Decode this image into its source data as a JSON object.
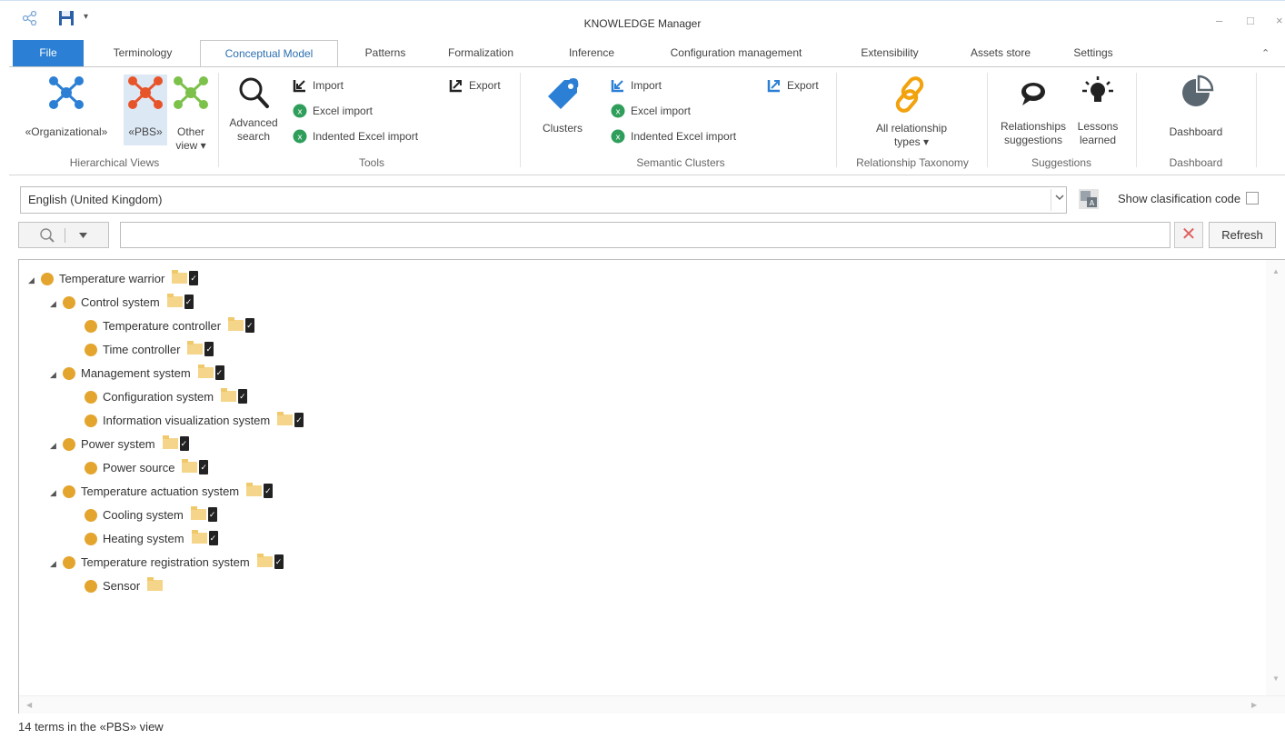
{
  "window": {
    "title": "KNOWLEDGE Manager",
    "quick_access": [
      "share-icon",
      "save-icon",
      "customize-quick-access-icon"
    ],
    "controls": [
      "–",
      "□",
      "×"
    ]
  },
  "tabs": [
    {
      "label": "File"
    },
    {
      "label": "Terminology"
    },
    {
      "label": "Conceptual Model",
      "active": true
    },
    {
      "label": "Patterns"
    },
    {
      "label": "Formalization"
    },
    {
      "label": "Inference"
    },
    {
      "label": "Configuration management"
    },
    {
      "label": "Extensibility"
    },
    {
      "label": "Assets store"
    },
    {
      "label": "Settings"
    }
  ],
  "ribbon": {
    "hierarchical_views": {
      "label": "Hierarchical Views",
      "organizational": "«Organizational»",
      "pbs": "«PBS»",
      "other_view_1": "Other",
      "other_view_2": "view ▾"
    },
    "tools": {
      "label": "Tools",
      "advanced_search_1": "Advanced",
      "advanced_search_2": "search",
      "import": "Import",
      "excel_import": "Excel import",
      "indented_excel_import": "Indented Excel import",
      "export": "Export"
    },
    "semantic_clusters": {
      "label": "Semantic Clusters",
      "clusters": "Clusters",
      "import": "Import",
      "excel_import": "Excel import",
      "indented_excel_import": "Indented Excel import",
      "export": "Export"
    },
    "relationship_taxonomy": {
      "label": "Relationship Taxonomy",
      "all_types_1": "All relationship",
      "all_types_2": "types ▾"
    },
    "suggestions": {
      "label": "Suggestions",
      "relationships_1": "Relationships",
      "relationships_2": "suggestions",
      "lessons_1": "Lessons",
      "lessons_2": "learned"
    },
    "dashboard": {
      "label": "Dashboard",
      "button": "Dashboard"
    },
    "colors": {
      "accent_blue": "#2b7fd4",
      "pbs_red": "#e8542a",
      "node_green": "#7cc14a",
      "link_orange": "#f2a20d",
      "excel_green": "#2f9e5b"
    }
  },
  "language": {
    "selected": "English (United Kingdom)",
    "show_code_label": "Show clasification code"
  },
  "search": {
    "value": "",
    "refresh_label": "Refresh"
  },
  "tree": [
    {
      "label": "Temperature warrior",
      "level": 0,
      "expanded": true
    },
    {
      "label": "Control system",
      "level": 1,
      "expanded": true
    },
    {
      "label": "Temperature controller",
      "level": 2
    },
    {
      "label": "Time controller",
      "level": 2
    },
    {
      "label": "Management system",
      "level": 1,
      "expanded": true
    },
    {
      "label": "Configuration system",
      "level": 2
    },
    {
      "label": "Information visualization system",
      "level": 2
    },
    {
      "label": "Power system",
      "level": 1,
      "expanded": true
    },
    {
      "label": "Power source",
      "level": 2
    },
    {
      "label": "Temperature actuation system",
      "level": 1,
      "expanded": true
    },
    {
      "label": "Cooling system",
      "level": 2
    },
    {
      "label": "Heating system",
      "level": 2
    },
    {
      "label": "Temperature registration system",
      "level": 1,
      "expanded": true
    },
    {
      "label": "Sensor",
      "level": 2,
      "no_doc": true
    }
  ],
  "status": {
    "text": "14 terms in the «PBS» view"
  }
}
